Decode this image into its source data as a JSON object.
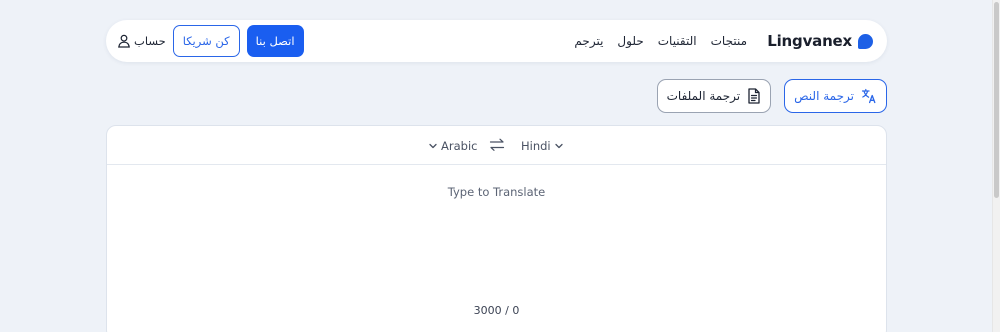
{
  "header": {
    "logo_text": "Lingvanex",
    "nav": [
      "منتجات",
      "التقنيات",
      "حلول",
      "يترجم"
    ],
    "account_label": "حساب",
    "partner_label": "كن شريكا",
    "contact_label": "اتصل بنا"
  },
  "modes": {
    "text_label": "ترجمة النص",
    "files_label": "ترجمة الملفات"
  },
  "translator": {
    "source_lang": "Arabic",
    "target_lang": "Hindi",
    "placeholder": "Type to Translate",
    "counter": "3000 / 0"
  },
  "colors": {
    "accent": "#1a5ef0",
    "background": "#eef2f8"
  },
  "icons": {
    "logo": "lingvanex-logo-icon",
    "account": "user-icon",
    "translate": "translate-icon",
    "document": "document-icon",
    "chevron": "chevron-down-icon",
    "swap": "swap-icon"
  }
}
